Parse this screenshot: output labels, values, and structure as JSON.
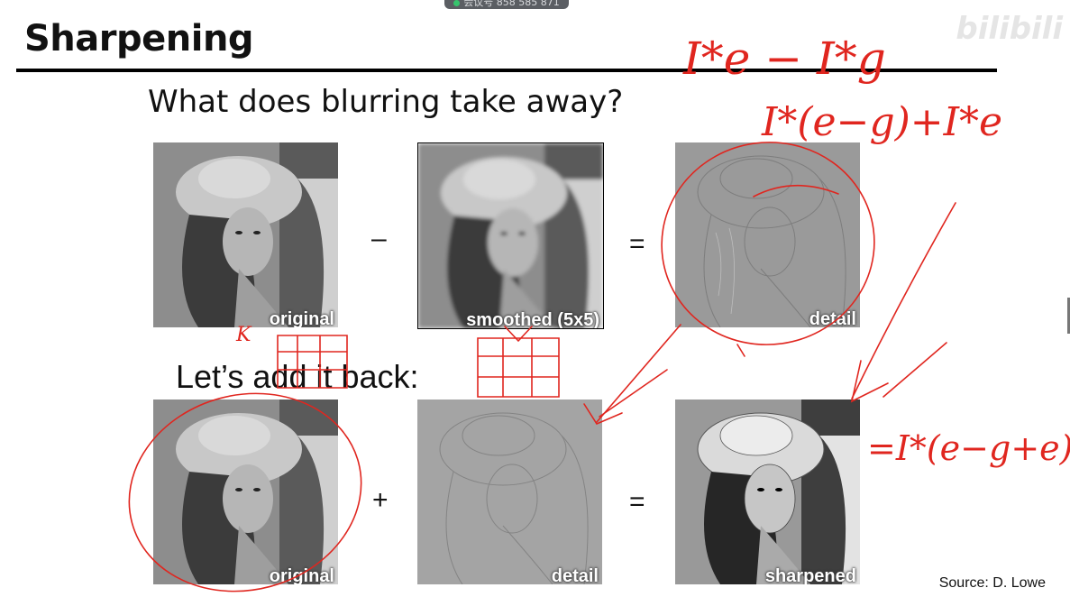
{
  "meeting_banner": {
    "text": "会议号 858 585 871"
  },
  "watermark": "bilibili",
  "slide": {
    "title": "Sharpening",
    "question": "What does blurring take away?",
    "lets_add": "Let’s add it back:",
    "source": "Source: D. Lowe",
    "row1": {
      "panels": [
        {
          "caption": "original",
          "kind": "photo"
        },
        {
          "caption": "smoothed (5x5)",
          "kind": "blur"
        },
        {
          "caption": "detail",
          "kind": "detail"
        }
      ],
      "op1": "–",
      "op2": "="
    },
    "row2": {
      "panels": [
        {
          "caption": "original",
          "kind": "photo"
        },
        {
          "caption": "detail",
          "kind": "detail"
        },
        {
          "caption": "sharpened",
          "kind": "sharp"
        }
      ],
      "op1": "+",
      "op2": "="
    }
  },
  "annotations": {
    "line1": "I*e − I*g",
    "line2": "I*(e−g)+I*e",
    "line3": "=I*(e−g+e)",
    "mark_k": "K"
  }
}
